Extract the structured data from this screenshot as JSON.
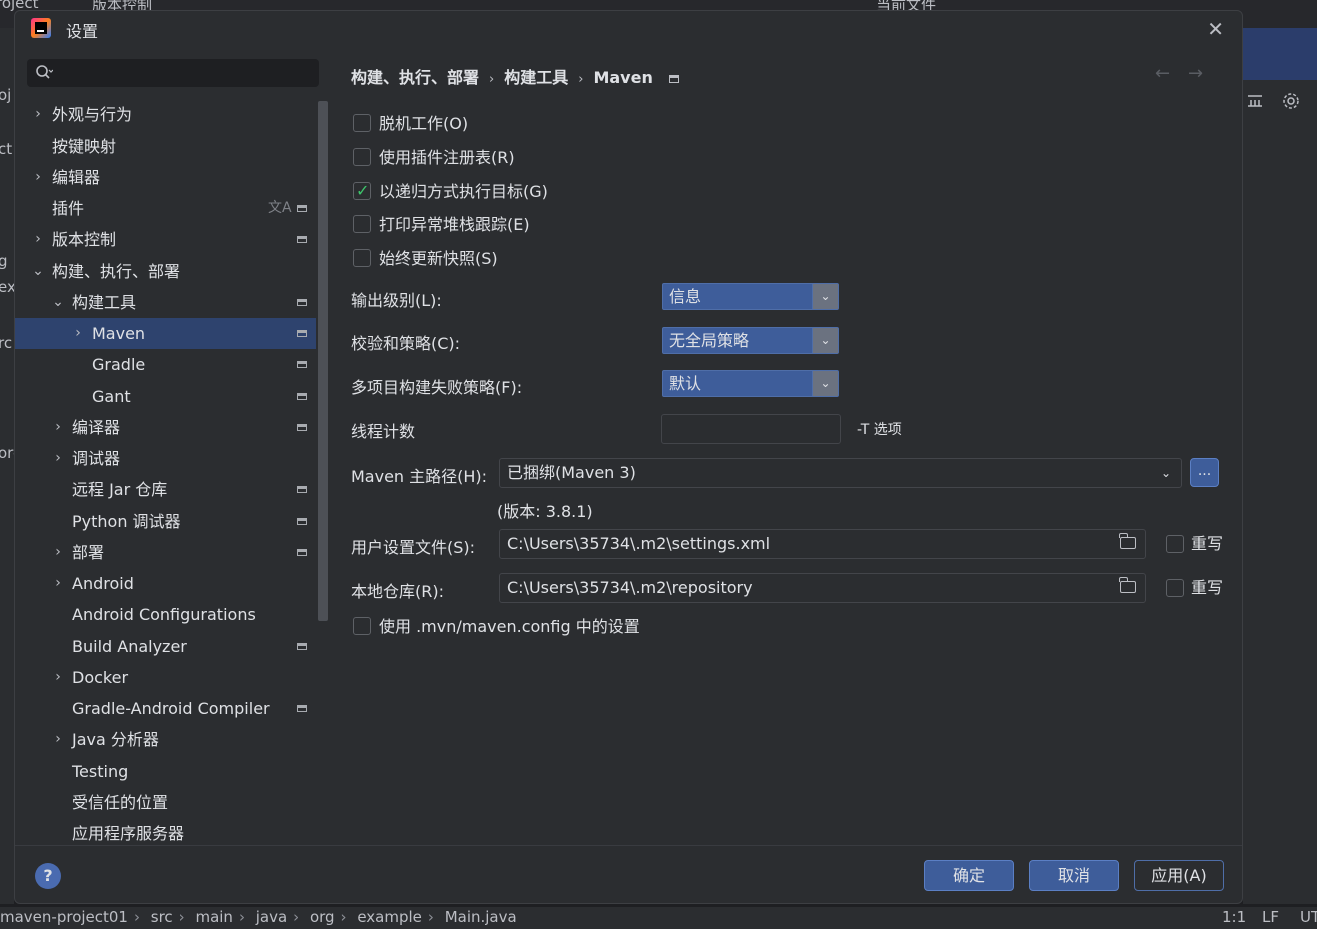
{
  "ide": {
    "top": {
      "project": "roject",
      "vcs": "版本控制",
      "current_file": "当前文件"
    },
    "left_fragments": [
      "oj",
      "ct",
      "g",
      "ex",
      "rc",
      "orc"
    ],
    "right_icons": [
      "run-icon",
      "debug-icon",
      "more-icon",
      "add-user-icon",
      "search-icon",
      "settings-icon"
    ]
  },
  "dialog": {
    "title": "设置",
    "close": "✕"
  },
  "sidebar": {
    "search_placeholder": "",
    "items": [
      {
        "label": "外观与行为",
        "chevron": "›"
      },
      {
        "label": "按键映射",
        "chevron": ""
      },
      {
        "label": "编辑器",
        "chevron": "›"
      },
      {
        "label": "插件",
        "chevron": ""
      },
      {
        "label": "版本控制",
        "chevron": "›"
      },
      {
        "label": "构建、执行、部署",
        "chevron": "⌄"
      },
      {
        "label": "构建工具",
        "chevron": "⌄"
      },
      {
        "label": "Maven",
        "chevron": "›"
      },
      {
        "label": "Gradle",
        "chevron": ""
      },
      {
        "label": "Gant",
        "chevron": ""
      },
      {
        "label": "编译器",
        "chevron": "›"
      },
      {
        "label": "调试器",
        "chevron": "›"
      },
      {
        "label": "远程 Jar 仓库",
        "chevron": ""
      },
      {
        "label": "Python 调试器",
        "chevron": ""
      },
      {
        "label": "部署",
        "chevron": "›"
      },
      {
        "label": "Android",
        "chevron": "›"
      },
      {
        "label": "Android Configurations",
        "chevron": ""
      },
      {
        "label": "Build Analyzer",
        "chevron": ""
      },
      {
        "label": "Docker",
        "chevron": "›"
      },
      {
        "label": "Gradle-Android Compiler",
        "chevron": ""
      },
      {
        "label": "Java 分析器",
        "chevron": "›"
      },
      {
        "label": "Testing",
        "chevron": ""
      },
      {
        "label": "受信任的位置",
        "chevron": ""
      },
      {
        "label": "应用程序服务器",
        "chevron": ""
      }
    ]
  },
  "breadcrumb": {
    "part1": "构建、执行、部署",
    "part2": "构建工具",
    "part3": "Maven",
    "sep": "›",
    "back": "←",
    "forward": "→"
  },
  "checkboxes": [
    {
      "label": "脱机工作(O)",
      "checked": false
    },
    {
      "label": "使用插件注册表(R)",
      "checked": false
    },
    {
      "label": "以递归方式执行目标(G)",
      "checked": true
    },
    {
      "label": "打印异常堆栈跟踪(E)",
      "checked": false
    },
    {
      "label": "始终更新快照(S)",
      "checked": false
    }
  ],
  "fields": {
    "output_level_label": "输出级别(L):",
    "output_level_value": "信息",
    "checksum_label": "校验和策略(C):",
    "checksum_value": "无全局策略",
    "multi_fail_label": "多项目构建失败策略(F):",
    "multi_fail_value": "默认",
    "thread_label": "线程计数",
    "thread_value": "",
    "thread_hint": "-T 选项",
    "maven_home_label": "Maven 主路径(H):",
    "maven_home_value": "已捆绑(Maven 3)",
    "browse": "...",
    "version": "(版本: 3.8.1)",
    "user_settings_label": "用户设置文件(S):",
    "user_settings_value": "C:\\Users\\35734\\.m2\\settings.xml",
    "override_label": "重写",
    "local_repo_label": "本地仓库(R):",
    "local_repo_value": "C:\\Users\\35734\\.m2\\repository",
    "use_mvn_config": "使用 .mvn/maven.config 中的设置",
    "dropdown_arrow": "⌄"
  },
  "footer": {
    "help": "?",
    "ok": "确定",
    "cancel": "取消",
    "apply": "应用(A)"
  },
  "statusbar": {
    "crumbs": [
      "maven-project01",
      "src",
      "main",
      "java",
      "org",
      "example",
      "Main.java"
    ],
    "position": "1:1",
    "line_sep": "LF",
    "encoding": "UT"
  }
}
